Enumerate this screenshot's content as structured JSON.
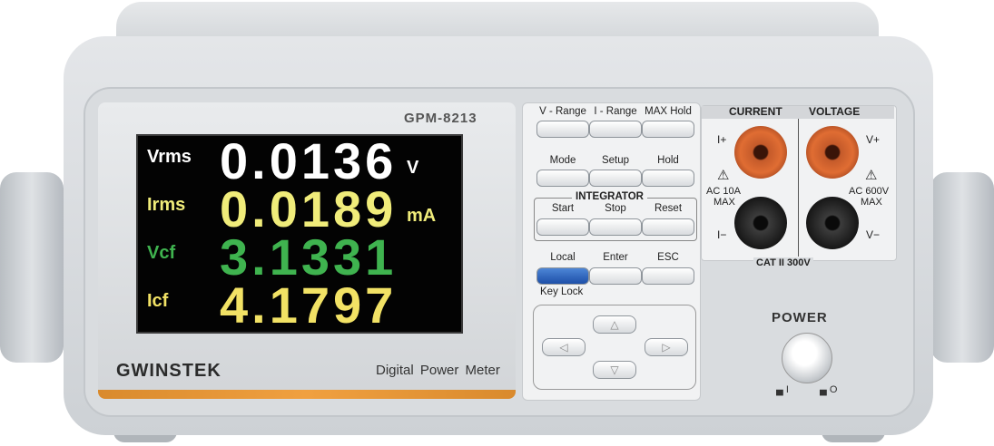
{
  "model": "GPM-8213",
  "brand": "GWINSTEK",
  "description": "Digital Power Meter",
  "readings": [
    {
      "label": "Vrms",
      "value": "0.0136",
      "unit": "V",
      "color": "#ffffff"
    },
    {
      "label": "Irms",
      "value": "0.0189",
      "unit": "mA",
      "color": "#f0ec7a"
    },
    {
      "label": "Vcf",
      "value": "3.1331",
      "unit": "",
      "color": "#3fb34f"
    },
    {
      "label": "Icf",
      "value": "4.1797",
      "unit": "",
      "color": "#f2e265"
    }
  ],
  "keys": {
    "row1": [
      "V - Range",
      "I - Range",
      "MAX Hold"
    ],
    "row2": [
      "Mode",
      "Setup",
      "Hold"
    ],
    "integrator_label": "INTEGRATOR",
    "row3": [
      "Start",
      "Stop",
      "Reset"
    ],
    "row4": [
      "Local",
      "Enter",
      "ESC"
    ],
    "key_lock": "Key Lock"
  },
  "terminals": {
    "current_header": "CURRENT",
    "voltage_header": "VOLTAGE",
    "current_plus": "I+",
    "current_minus": "I−",
    "voltage_plus": "V+",
    "voltage_minus": "V−",
    "current_rating_1": "AC 10A",
    "current_rating_2": "MAX",
    "voltage_rating_1": "AC 600V",
    "voltage_rating_2": "MAX",
    "category": "CAT II 300V"
  },
  "power": {
    "label": "POWER",
    "on_mark": "▄ I",
    "off_mark": "▄ O"
  }
}
